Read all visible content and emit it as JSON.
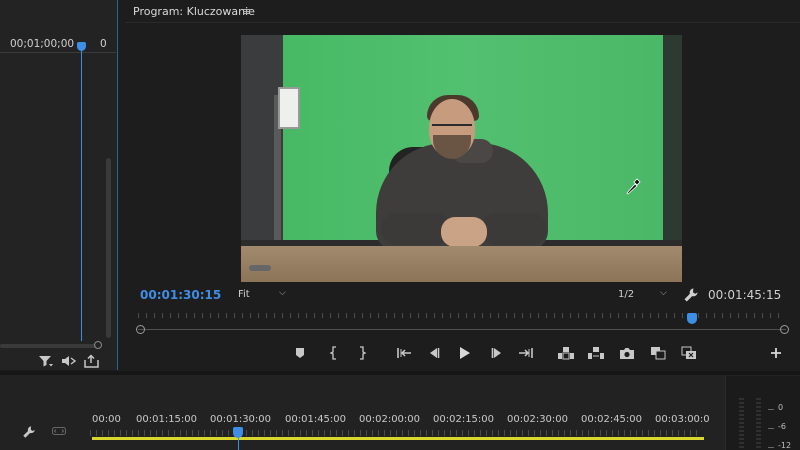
{
  "source_panel": {
    "timecode": "00;01;00;00",
    "timecode_2": "0"
  },
  "program_monitor": {
    "title": "Program: Kluczowanie",
    "current_timecode": "00:01:30:15",
    "zoom": "Fit",
    "resolution": "1/2",
    "duration": "00:01:45:15",
    "playhead_fraction": 0.86
  },
  "transport_buttons": [
    {
      "name": "add-marker-button",
      "icon": "marker"
    },
    {
      "name": "mark-in-button",
      "icon": "bracket-left"
    },
    {
      "name": "mark-out-button",
      "icon": "bracket-right"
    },
    {
      "name": "go-to-in-button",
      "icon": "go-to-in"
    },
    {
      "name": "step-back-button",
      "icon": "step-back"
    },
    {
      "name": "play-button",
      "icon": "play"
    },
    {
      "name": "step-forward-button",
      "icon": "step-forward"
    },
    {
      "name": "go-to-out-button",
      "icon": "go-to-out"
    },
    {
      "name": "lift-button",
      "icon": "lift"
    },
    {
      "name": "extract-button",
      "icon": "extract"
    },
    {
      "name": "export-frame-button",
      "icon": "camera"
    },
    {
      "name": "comparison-view-button",
      "icon": "comparison"
    },
    {
      "name": "proxy-toggle-button",
      "icon": "proxy"
    },
    {
      "name": "button-editor-button",
      "icon": "plus"
    }
  ],
  "timeline": {
    "ticks": [
      "00:00",
      "00:01:15:00",
      "00:01:30:00",
      "00:01:45:00",
      "00:02:00:00",
      "00:02:15:00",
      "00:02:30:00",
      "00:02:45:00",
      "00:03:00:0"
    ]
  },
  "audio_meter": {
    "labels": [
      "0",
      "-6",
      "-12"
    ]
  },
  "colors": {
    "accent": "#3f8ee6",
    "work_area": "#d9d82f",
    "green_screen": "#4dbd6a",
    "panel_bg": "#1d1d1d"
  }
}
